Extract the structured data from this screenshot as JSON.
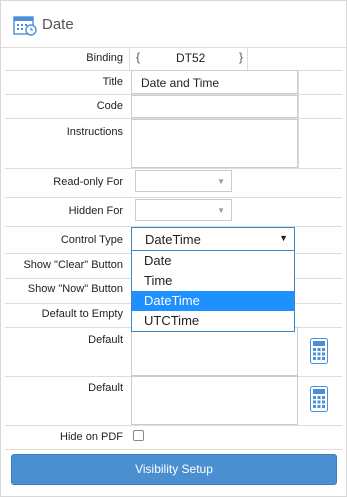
{
  "header": {
    "title": "Date",
    "icon": "calendar-clock-icon"
  },
  "fields": {
    "binding": {
      "label": "Binding",
      "open_brace": "{",
      "value": "DT52",
      "close_brace": "}"
    },
    "title": {
      "label": "Title",
      "value": "Date and Time"
    },
    "code": {
      "label": "Code",
      "value": ""
    },
    "instructions": {
      "label": "Instructions",
      "value": ""
    },
    "readonly_for": {
      "label": "Read-only For",
      "value": ""
    },
    "hidden_for": {
      "label": "Hidden For",
      "value": ""
    },
    "control_type": {
      "label": "Control Type",
      "value": "DateTime",
      "options": [
        "Date",
        "Time",
        "DateTime",
        "UTCTime"
      ],
      "highlighted": "DateTime"
    },
    "show_clear": {
      "label": "Show \"Clear\" Button"
    },
    "show_now": {
      "label": "Show \"Now\" Button"
    },
    "default_to_empty": {
      "label": "Default to Empty"
    },
    "default1": {
      "label": "Default",
      "value": ""
    },
    "default2": {
      "label": "Default",
      "value": ""
    },
    "hide_on_pdf": {
      "label": "Hide on PDF",
      "checked": false
    }
  },
  "visibility_button": {
    "label": "Visibility Setup"
  },
  "colors": {
    "accent": "#3a87c9",
    "button": "#4a8fd0",
    "highlight": "#1e90ff"
  }
}
